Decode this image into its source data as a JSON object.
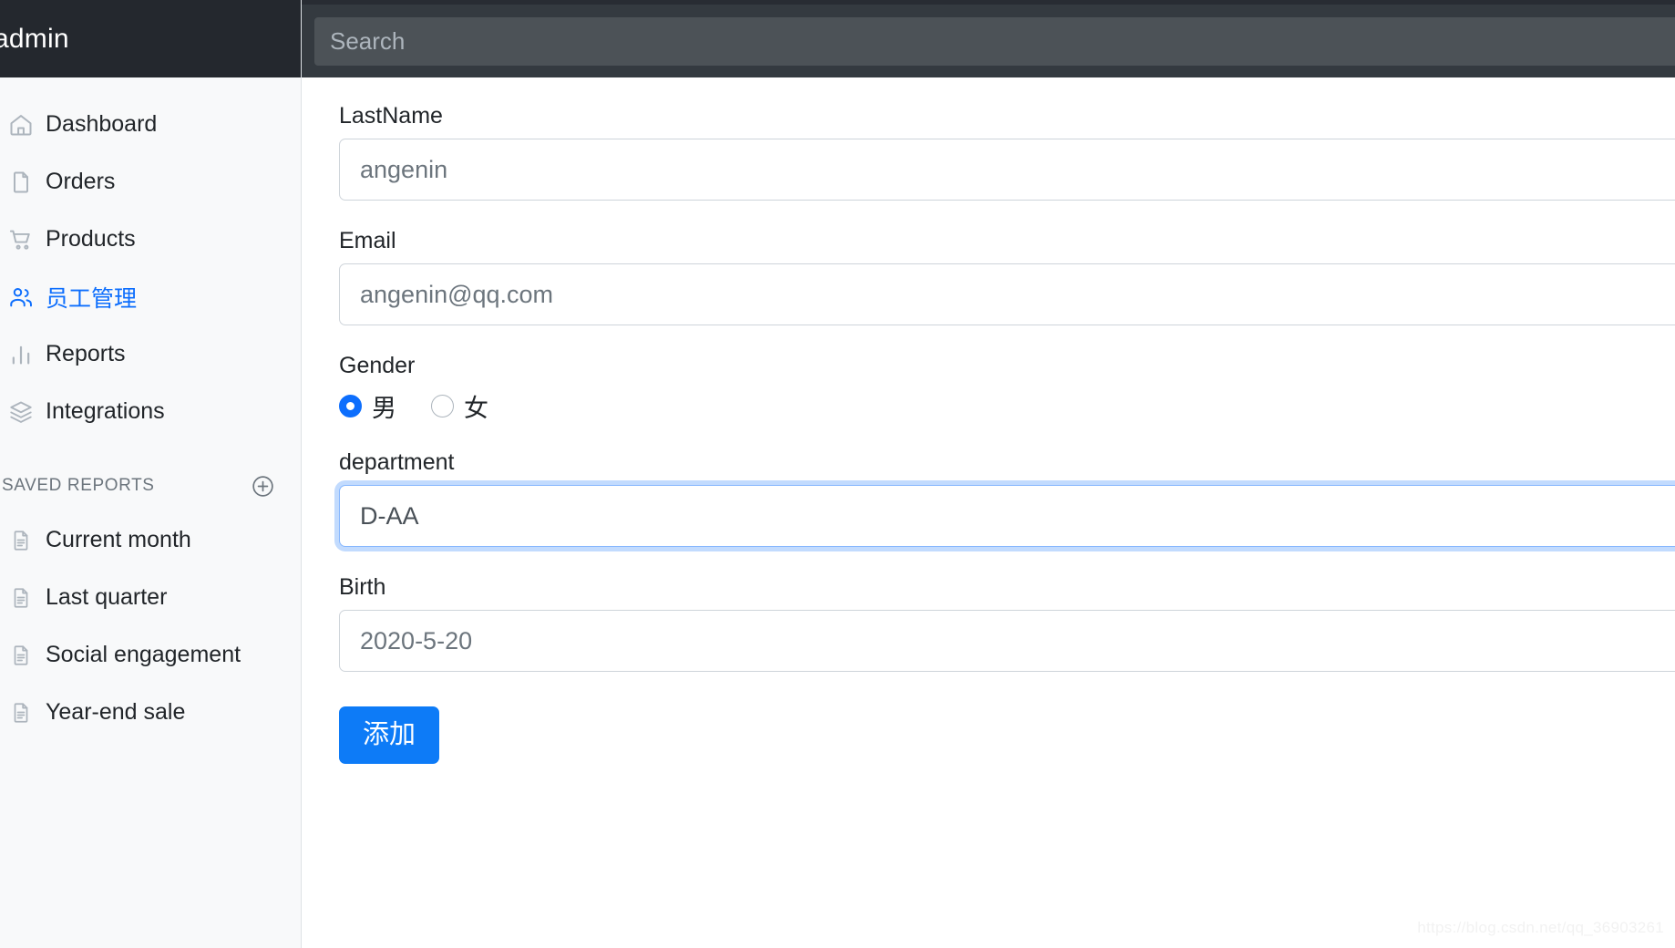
{
  "brand": {
    "title": "admin"
  },
  "navbar": {
    "search": {
      "placeholder": "Search",
      "value": ""
    }
  },
  "sidebar": {
    "items": [
      {
        "label": "Dashboard",
        "icon": "home-icon",
        "active": false
      },
      {
        "label": "Orders",
        "icon": "file-icon",
        "active": false
      },
      {
        "label": "Products",
        "icon": "cart-icon",
        "active": false
      },
      {
        "label": "员工管理",
        "icon": "people-icon",
        "active": true
      },
      {
        "label": "Reports",
        "icon": "bar-chart-icon",
        "active": false
      },
      {
        "label": "Integrations",
        "icon": "layers-icon",
        "active": false
      }
    ],
    "saved_reports": {
      "heading": "SAVED REPORTS",
      "add_icon": "plus-circle-icon",
      "items": [
        {
          "label": "Current month",
          "icon": "file-text-icon"
        },
        {
          "label": "Last quarter",
          "icon": "file-text-icon"
        },
        {
          "label": "Social engagement",
          "icon": "file-text-icon"
        },
        {
          "label": "Year-end sale",
          "icon": "file-text-icon"
        }
      ]
    }
  },
  "form": {
    "lastname": {
      "label": "LastName",
      "value": "",
      "placeholder": "angenin"
    },
    "email": {
      "label": "Email",
      "value": "",
      "placeholder": "angenin@qq.com"
    },
    "gender": {
      "label": "Gender",
      "options": [
        {
          "label": "男",
          "checked": true
        },
        {
          "label": "女",
          "checked": false
        }
      ]
    },
    "department": {
      "label": "department",
      "value": "D-AA",
      "placeholder": "",
      "focused": true
    },
    "birth": {
      "label": "Birth",
      "value": "",
      "placeholder": "2020-5-20"
    },
    "submit": {
      "label": "添加"
    }
  },
  "watermark": {
    "text": "https://blog.csdn.net/qq_36903261"
  },
  "colors": {
    "accent": "#0d6efd",
    "button": "#0d7bf7",
    "navbar_bg": "#343a40",
    "sidebar_bg": "#f8f9fa",
    "sidebar_header_bg": "#24282e"
  }
}
